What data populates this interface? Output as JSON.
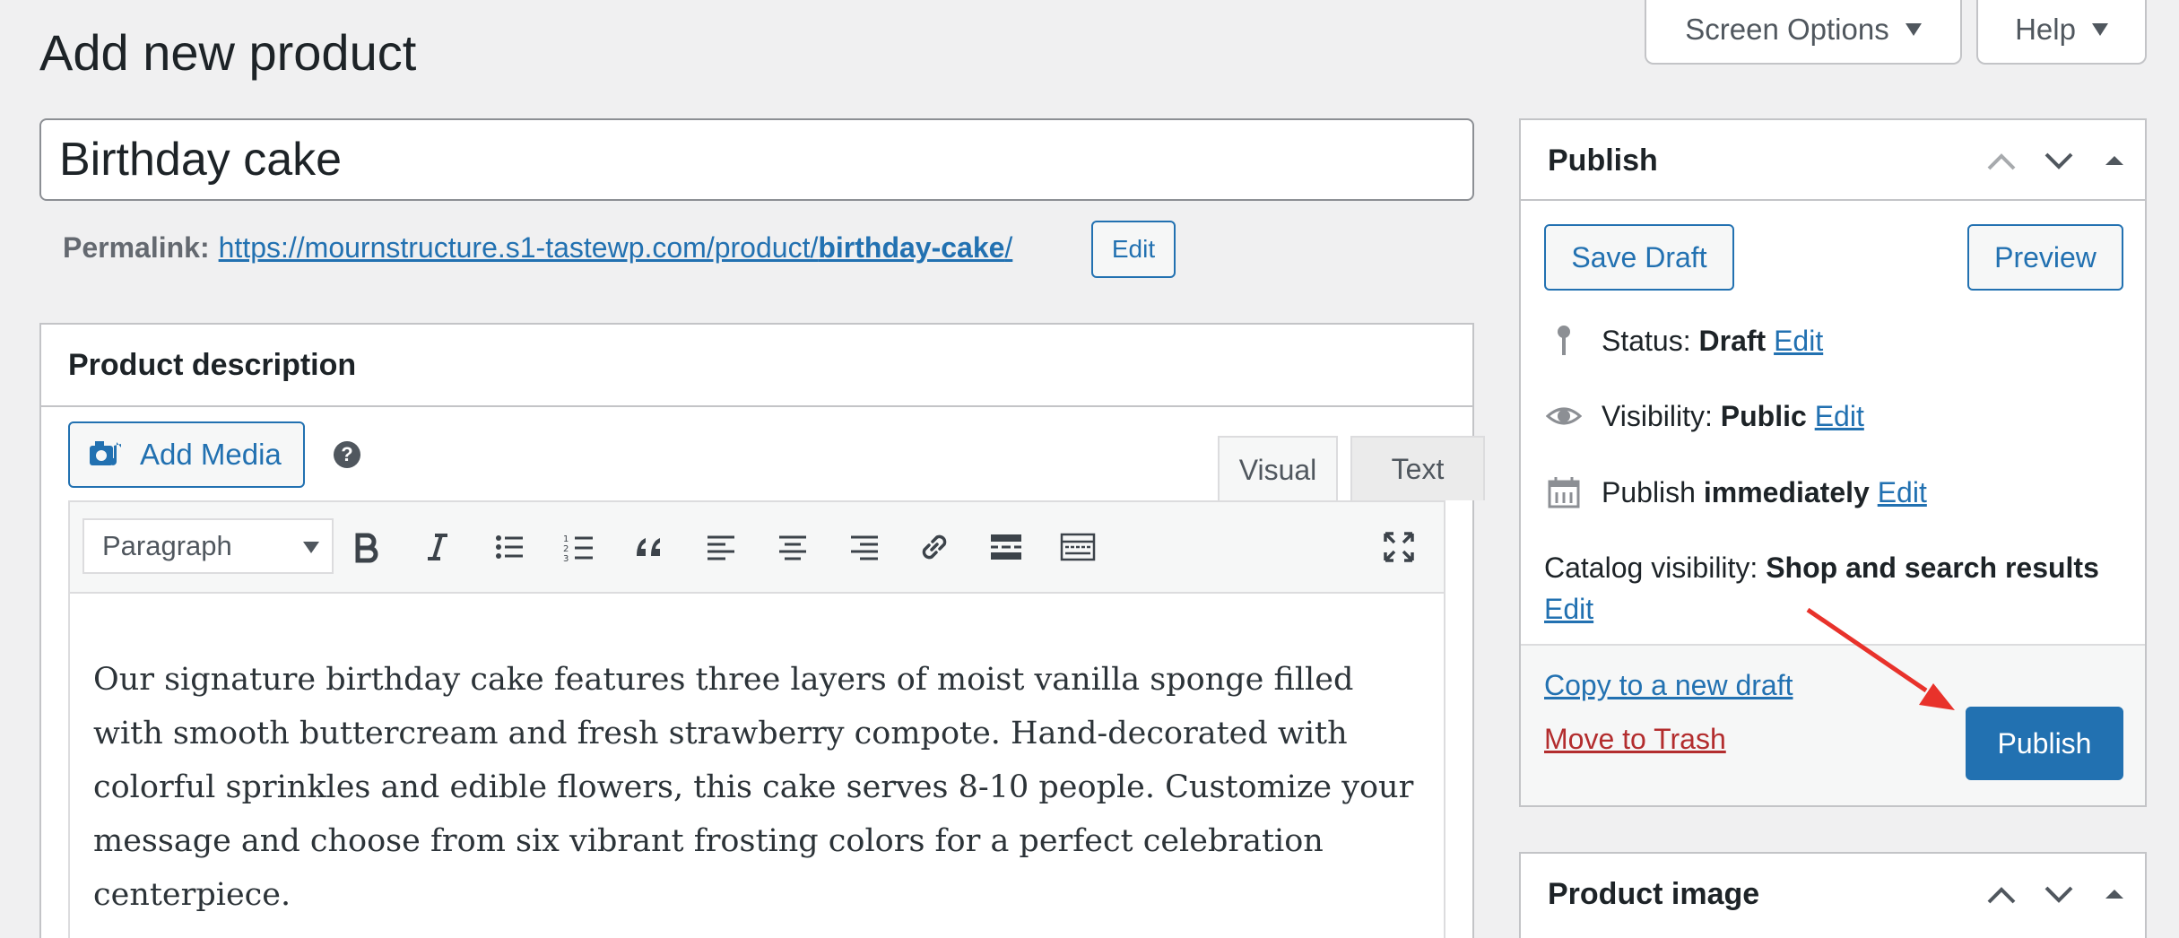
{
  "header": {
    "page_title": "Add new product",
    "screen_options_label": "Screen Options",
    "help_label": "Help"
  },
  "title_field": {
    "value": "Birthday cake"
  },
  "permalink": {
    "label": "Permalink:",
    "url_base": "https://mournstructure.s1-tastewp.com/product/",
    "slug": "birthday-cake",
    "url_trailing": "/",
    "edit_label": "Edit"
  },
  "description": {
    "header": "Product description",
    "add_media_label": "Add Media",
    "help_glyph": "?",
    "tabs": {
      "visual": "Visual",
      "text": "Text"
    },
    "format_select": "Paragraph",
    "toolbar_icons": [
      "bold-icon",
      "italic-icon",
      "bullet-list-icon",
      "numbered-list-icon",
      "blockquote-icon",
      "align-left-icon",
      "align-center-icon",
      "align-right-icon",
      "link-icon",
      "read-more-icon",
      "toolbar-toggle-icon",
      "fullscreen-icon"
    ],
    "content": "Our signature birthday cake features three layers of moist vanilla sponge filled with smooth buttercream and fresh strawberry compote. Hand-decorated with colorful sprinkles and edible flowers, this cake serves 8-10 people. Customize your message and choose from six vibrant frosting colors for a perfect celebration centerpiece."
  },
  "publish": {
    "title": "Publish",
    "save_draft_label": "Save Draft",
    "preview_label": "Preview",
    "status_label": "Status:",
    "status_value": "Draft",
    "visibility_label": "Visibility:",
    "visibility_value": "Public",
    "publish_label": "Publish",
    "publish_value": "immediately",
    "catalog_label": "Catalog visibility:",
    "catalog_value": "Shop and search results",
    "edit_label": "Edit",
    "copy_draft_label": "Copy to a new draft",
    "move_trash_label": "Move to Trash",
    "publish_button_label": "Publish"
  },
  "product_image": {
    "title": "Product image"
  },
  "colors": {
    "accent": "#2271b1",
    "danger": "#b32d2e",
    "background": "#f0f0f1",
    "annotation_arrow": "#e8322b"
  }
}
